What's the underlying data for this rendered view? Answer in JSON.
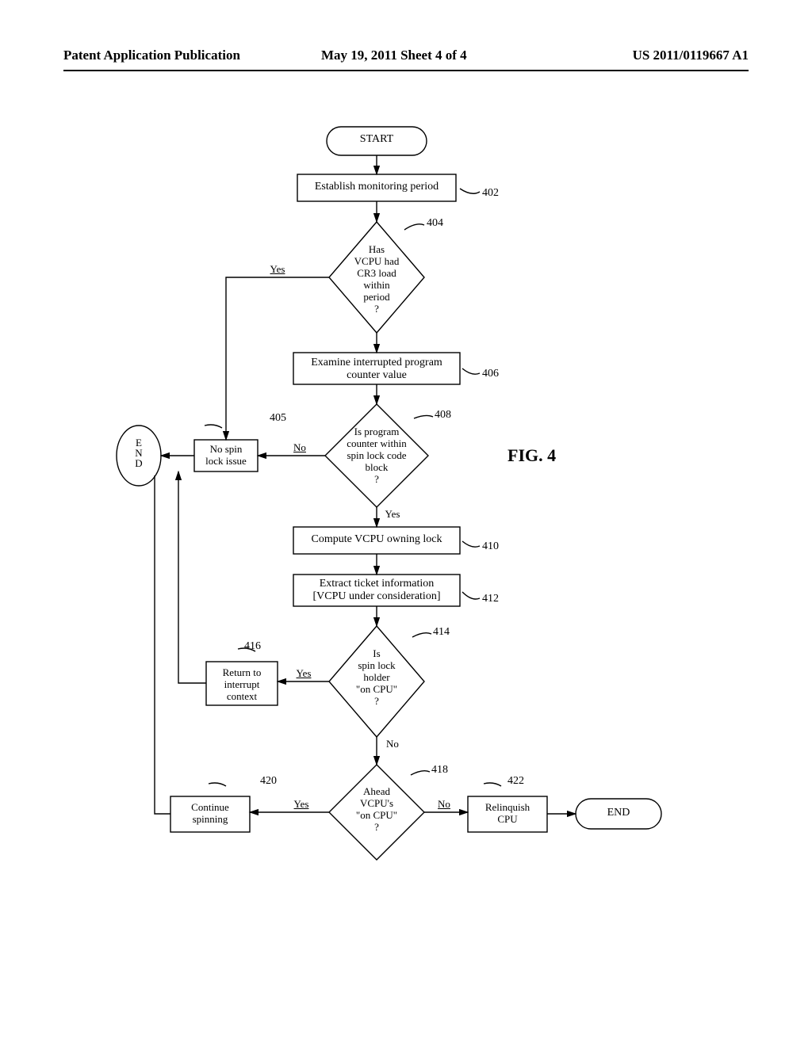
{
  "header": {
    "left": "Patent Application Publication",
    "center": "May 19, 2011  Sheet 4 of 4",
    "right": "US 2011/0119667 A1"
  },
  "figure_label": "FIG.  4",
  "nodes": {
    "start": "START",
    "end_left": "E\nN\nD",
    "end_right": "END",
    "box_402": "Establish monitoring period",
    "dia_404": "Has\nVCPU had\nCR3 load\nwithin\nperiod\n?",
    "box_406": "Examine interrupted program\ncounter value",
    "box_405": "No spin\nlock issue",
    "dia_408": "Is program\ncounter within\nspin lock code\nblock\n?",
    "box_410": "Compute VCPU owning lock",
    "box_412": "Extract ticket information\n[VCPU under consideration]",
    "dia_414": "Is\nspin lock\nholder\n\"on CPU\"\n?",
    "box_416": "Return to\ninterrupt\ncontext",
    "dia_418": "Ahead\nVCPU's\n\"on CPU\"\n?",
    "box_420": "Continue\nspinning",
    "box_422": "Relinquish\nCPU"
  },
  "edge_labels": {
    "yes_404": "Yes",
    "no_408": "No",
    "yes_408": "Yes",
    "yes_414": "Yes",
    "no_414": "No",
    "yes_418": "Yes",
    "no_418": "No"
  },
  "refs": {
    "r402": "402",
    "r404": "404",
    "r405": "405",
    "r406": "406",
    "r408": "408",
    "r410": "410",
    "r412": "412",
    "r414": "414",
    "r416": "416",
    "r418": "418",
    "r420": "420",
    "r422": "422"
  }
}
